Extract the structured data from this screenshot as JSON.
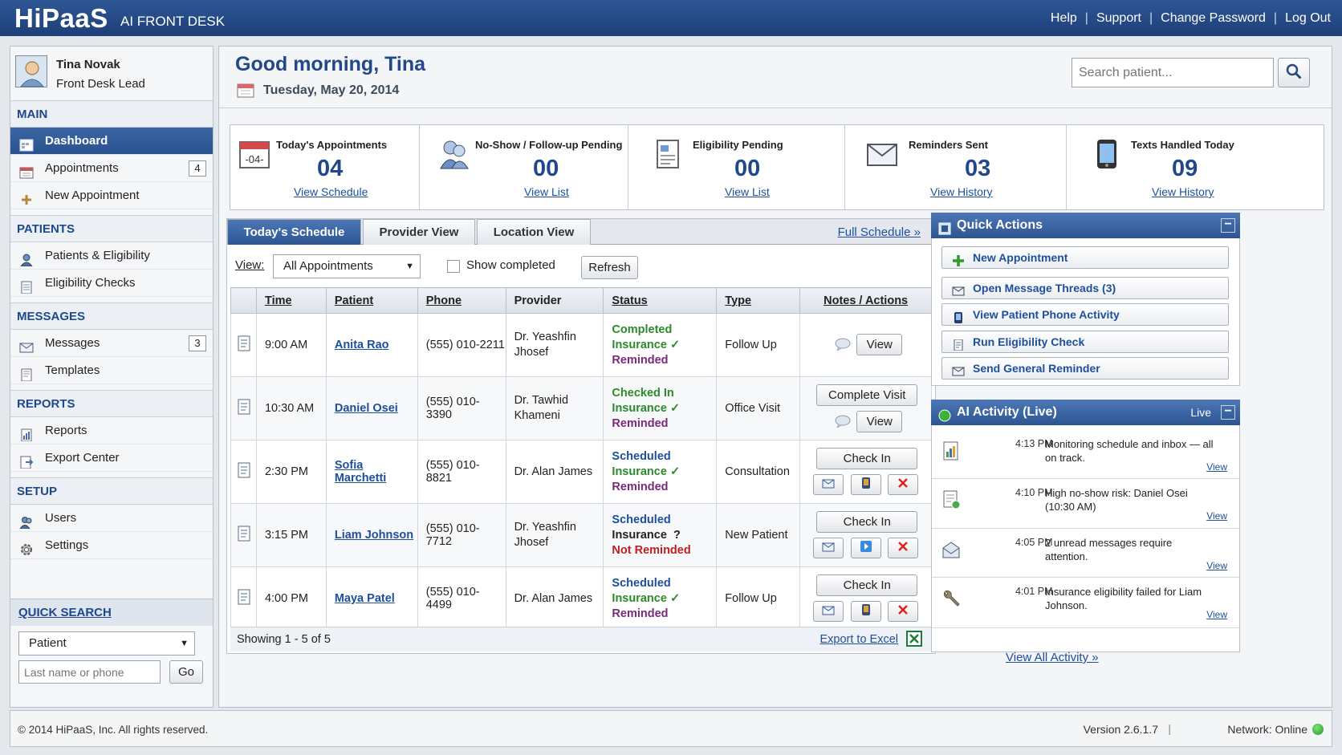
{
  "header": {
    "logo": "HiPaaS",
    "subtitle": "AI FRONT DESK",
    "links": [
      "Help",
      "Support",
      "Change Password",
      "Log Out"
    ]
  },
  "user": {
    "name": "Tina Novak",
    "role": "Front Desk Lead"
  },
  "sidebar": {
    "sections": {
      "main": "MAIN",
      "patients": "PATIENTS",
      "messages": "MESSAGES",
      "reports": "REPORTS",
      "setup": "SETUP"
    },
    "items": {
      "dashboard": "Dashboard",
      "appointments": "Appointments",
      "appointments_badge": "4",
      "new_appointment": "New Appointment",
      "patients_eligibility": "Patients & Eligibility",
      "eligibility_checks": "Eligibility Checks",
      "messages": "Messages",
      "messages_badge": "3",
      "templates": "Templates",
      "reports": "Reports",
      "export_center": "Export Center",
      "users": "Users",
      "settings": "Settings"
    },
    "quick_search": {
      "title": "QUICK SEARCH",
      "type": "Patient",
      "placeholder": "Last name or phone",
      "go": "Go"
    }
  },
  "main": {
    "greeting": "Good morning, Tina",
    "date": "Tuesday, May 20, 2014",
    "search_placeholder": "Search patient...",
    "stats": [
      {
        "title": "Today's Appointments",
        "value": "04",
        "link": "View Schedule",
        "icon": "calendar-icon"
      },
      {
        "title": "No-Show / Follow-up Pending",
        "value": "00",
        "link": "View List",
        "icon": "users-icon"
      },
      {
        "title": "Eligibility Pending",
        "value": "00",
        "link": "View List",
        "icon": "document-icon"
      },
      {
        "title": "Reminders Sent",
        "value": "03",
        "link": "View History",
        "icon": "envelope-icon"
      },
      {
        "title": "Texts Handled Today",
        "value": "09",
        "link": "View History",
        "icon": "phone-icon"
      }
    ]
  },
  "schedule": {
    "tabs": [
      "Today's Schedule",
      "Provider View",
      "Location View"
    ],
    "full_schedule": "Full Schedule »",
    "view_label": "View:",
    "view_value": "All Appointments",
    "show_completed": "Show completed",
    "refresh": "Refresh",
    "columns": [
      "Time",
      "Patient",
      "Phone",
      "Provider",
      "Status",
      "Type",
      "Notes / Actions"
    ],
    "rows": [
      {
        "time": "9:00 AM",
        "patient": "Anita Rao",
        "phone": "(555) 010-2211",
        "provider": "Dr. Yeashfin Jhosef",
        "status1": "Completed",
        "status2": "Insurance ✓",
        "status3": "Reminded",
        "type": "Follow Up",
        "primary": "View"
      },
      {
        "time": "10:30 AM",
        "patient": "Daniel Osei",
        "phone": "(555) 010-3390",
        "provider": "Dr. Tawhid Khameni",
        "status1": "Checked In",
        "status2": "Insurance ✓",
        "status3": "Reminded",
        "type": "Office Visit",
        "primary": "Complete Visit",
        "secondary": "View"
      },
      {
        "time": "2:30 PM",
        "patient": "Sofia Marchetti",
        "phone": "(555) 010-8821",
        "provider": "Dr. Alan James",
        "status1": "Scheduled",
        "status2": "Insurance ✓",
        "status3": "Reminded",
        "type": "Consultation",
        "primary": "Check In"
      },
      {
        "time": "3:15 PM",
        "patient": "Liam Johnson",
        "phone": "(555) 010-7712",
        "provider": "Dr. Yeashfin Jhosef",
        "status1": "Scheduled",
        "status2": "Insurance  ?",
        "status3": "Not Reminded",
        "type": "New Patient",
        "primary": "Check In"
      },
      {
        "time": "4:00 PM",
        "patient": "Maya Patel",
        "phone": "(555) 010-4499",
        "provider": "Dr. Alan James",
        "status1": "Scheduled",
        "status2": "Insurance ✓",
        "status3": "Reminded",
        "type": "Follow Up",
        "primary": "Check In"
      }
    ],
    "showing": "Showing 1 - 5 of 5",
    "export": "Export to Excel"
  },
  "quick_actions": {
    "title": "Quick Actions",
    "items": [
      "New Appointment",
      "Open Message Threads (3)",
      "View Patient Phone Activity",
      "Run Eligibility Check",
      "Send General Reminder"
    ]
  },
  "ai_activity": {
    "title": "AI Activity (Live)",
    "live": "Live",
    "items": [
      {
        "time": "4:13 PM",
        "message": "Monitoring schedule and inbox — all on track.",
        "link": "View"
      },
      {
        "time": "4:10 PM",
        "message": "High no-show risk: Daniel Osei (10:30 AM)",
        "link": "View"
      },
      {
        "time": "4:05 PM",
        "message": "2 unread messages require attention.",
        "link": "View"
      },
      {
        "time": "4:01 PM",
        "message": "Insurance eligibility failed for Liam Johnson.",
        "link": "View"
      }
    ],
    "view_all": "View All Activity »"
  },
  "footer": {
    "copyright": "© 2014 HiPaaS, Inc. All rights reserved.",
    "version": "Version 2.6.1.7",
    "network": "Network: Online"
  },
  "colors": {
    "brand": "#21488a",
    "completed": "#2c8a2c",
    "warning": "#c01e1e",
    "online": "#1f9a25"
  }
}
